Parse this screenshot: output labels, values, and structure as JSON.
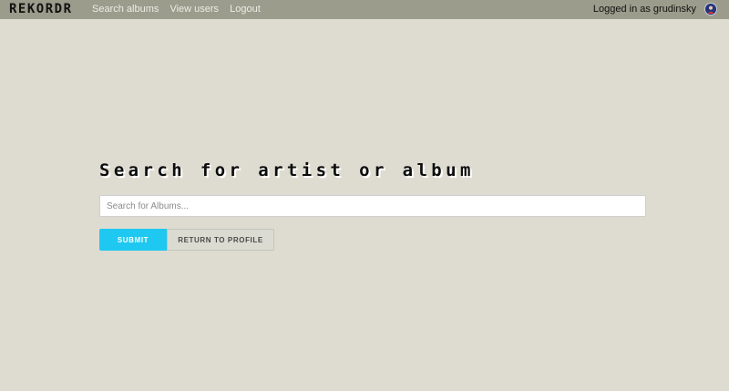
{
  "navbar": {
    "brand": "REKORDR",
    "links": [
      {
        "label": "Search albums"
      },
      {
        "label": "View users"
      },
      {
        "label": "Logout"
      }
    ],
    "user_text": "Logged in as grudinsky",
    "avatar_icon": "user-avatar-icon"
  },
  "main": {
    "heading": "Search for artist or album",
    "search": {
      "placeholder": "Search for Albums...",
      "value": ""
    },
    "buttons": {
      "submit_label": "SUBMIT",
      "return_label": "RETURN TO PROFILE"
    }
  },
  "colors": {
    "background": "#dedcd0",
    "navbar": "#9c9c8c",
    "accent": "#1fc8f0"
  }
}
